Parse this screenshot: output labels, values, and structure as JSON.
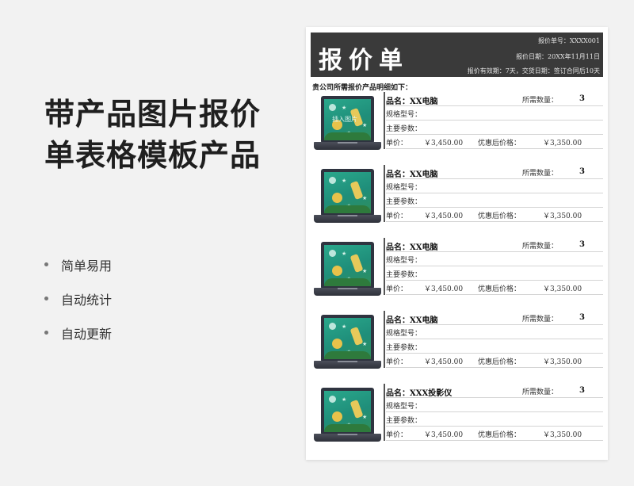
{
  "promo": {
    "title_line1": "带产品图片报价",
    "title_line2": "单表格模板产品",
    "features": [
      "简单易用",
      "自动统计",
      "自动更新"
    ]
  },
  "quote": {
    "title": "报价单",
    "number": "报价单号：XXXX001",
    "date": "报价日期：20XX年11月11日",
    "validity": "报价有效期：7天，交货日期：签订合同后10天",
    "intro": "贵公司所需报价产品明细如下：",
    "image_placeholder": "插入图片",
    "labels": {
      "name": "品名：",
      "qty": "所需数量：",
      "spec": "规格型号：",
      "params": "主要参数：",
      "unit_price": "单价：",
      "discount_price": "优惠后价格："
    },
    "items": [
      {
        "name": "XX电脑",
        "qty": "3",
        "unit_price": "￥3,450.00",
        "discount_price": "￥3,350.00"
      },
      {
        "name": "XX电脑",
        "qty": "3",
        "unit_price": "￥3,450.00",
        "discount_price": "￥3,350.00"
      },
      {
        "name": "XX电脑",
        "qty": "3",
        "unit_price": "￥3,450.00",
        "discount_price": "￥3,350.00"
      },
      {
        "name": "XX电脑",
        "qty": "3",
        "unit_price": "￥3,450.00",
        "discount_price": "￥3,350.00"
      },
      {
        "name": "XXX投影仪",
        "qty": "3",
        "unit_price": "￥3,450.00",
        "discount_price": "￥3,350.00"
      }
    ]
  }
}
